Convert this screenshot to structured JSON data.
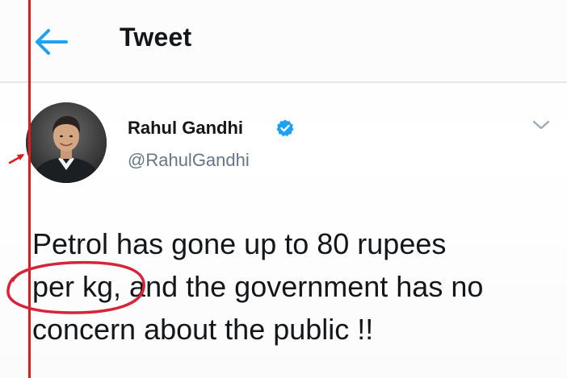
{
  "header": {
    "back_icon": "arrow-left-icon",
    "title": "Tweet"
  },
  "tweet": {
    "author": {
      "name": "Rahul Gandhi",
      "handle": "@RahulGandhi",
      "verified": true,
      "avatar_icon": "profile-photo"
    },
    "menu_icon": "chevron-down-icon",
    "text_lines": [
      "Petrol has gone up to 80 rupees",
      "per kg, and the government has no",
      "concern about the public !!"
    ]
  },
  "colors": {
    "accent": "#1da1f2",
    "text_primary": "#14171a",
    "text_secondary": "#657786",
    "divider": "#e3e6e8",
    "annotation": "#e01a1a"
  }
}
